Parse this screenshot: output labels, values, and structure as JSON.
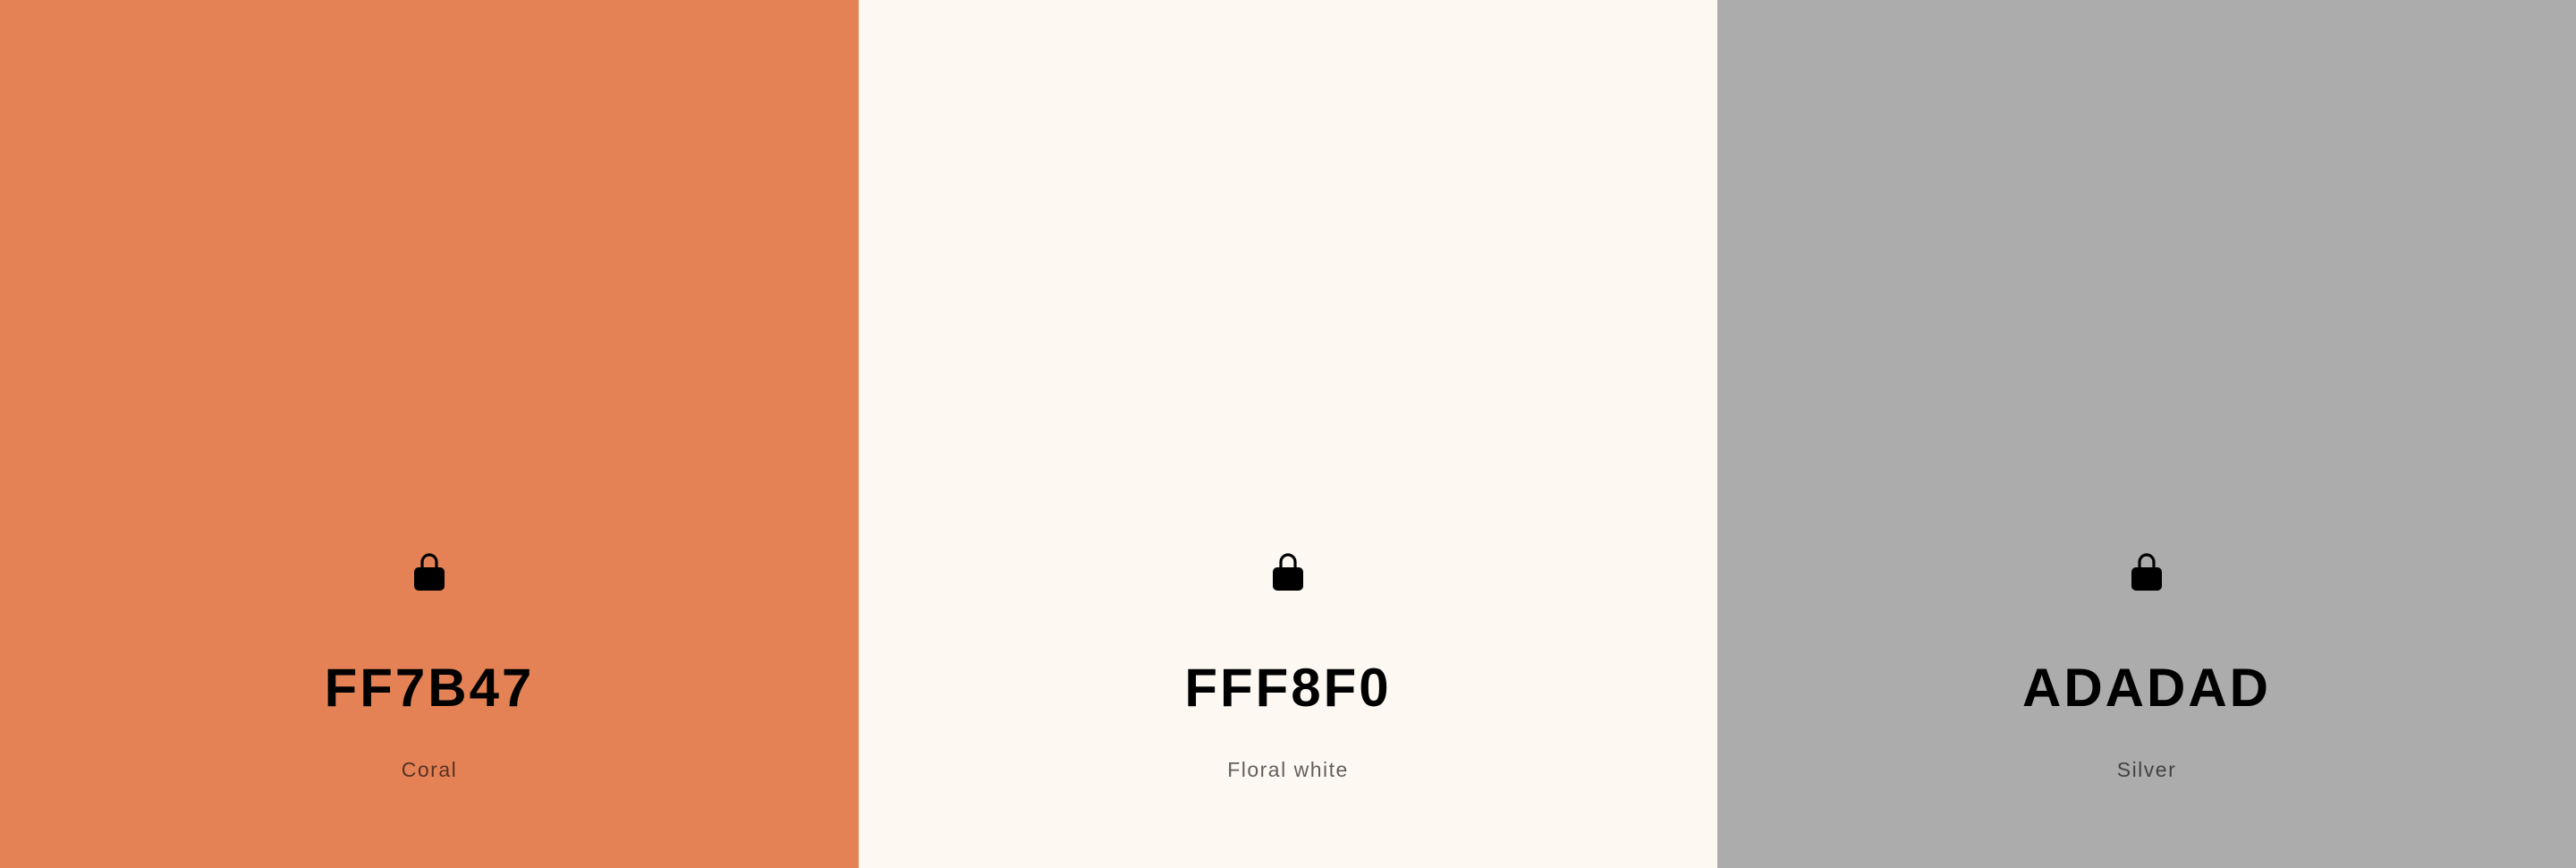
{
  "palette": {
    "swatches": [
      {
        "hex": "FF7B47",
        "name": "Coral",
        "background": "#E48256",
        "icon": "lock-icon"
      },
      {
        "hex": "FFF8F0",
        "name": "Floral white",
        "background": "#FDF8F2",
        "icon": "lock-icon"
      },
      {
        "hex": "ADADAD",
        "name": "Silver",
        "background": "#ACACAC",
        "icon": "lock-icon"
      }
    ]
  }
}
